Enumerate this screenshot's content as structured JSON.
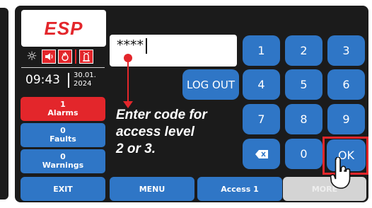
{
  "brand": {
    "logo": "ESP"
  },
  "status": {
    "icons": [
      "sun-icon",
      "speaker-icon",
      "fire-icon",
      "fire-alarm-icon"
    ],
    "time": "09:43",
    "date_line1": "30.01.",
    "date_line2": "2024"
  },
  "sidebar": [
    {
      "count": "1",
      "label": "Alarms",
      "color": "#e3262b"
    },
    {
      "count": "0",
      "label": "Faults",
      "color": "#2f76c6"
    },
    {
      "count": "0",
      "label": "Warnings",
      "color": "#2f76c6"
    }
  ],
  "code_field": {
    "value": "****"
  },
  "buttons": {
    "logout": "LOG OUT"
  },
  "keypad": {
    "keys": [
      "1",
      "2",
      "3",
      "4",
      "5",
      "6",
      "7",
      "8",
      "9",
      "0",
      "OK"
    ],
    "backspace_icon": "backspace-icon"
  },
  "instruction": {
    "line1": "Enter code for",
    "line2": "access level",
    "line3": "2 or 3."
  },
  "bottom_bar": [
    {
      "label": "EXIT",
      "enabled": true
    },
    {
      "label": "MENU",
      "enabled": true
    },
    {
      "label": "Access 1",
      "enabled": true
    },
    {
      "label": "MORE",
      "enabled": false
    }
  ],
  "colors": {
    "accent_red": "#e3262b",
    "button_blue": "#2f76c6",
    "panel": "#1b1b1b",
    "disabled": "#d4d4d4"
  },
  "cursor_icon": "hand-pointer-icon"
}
